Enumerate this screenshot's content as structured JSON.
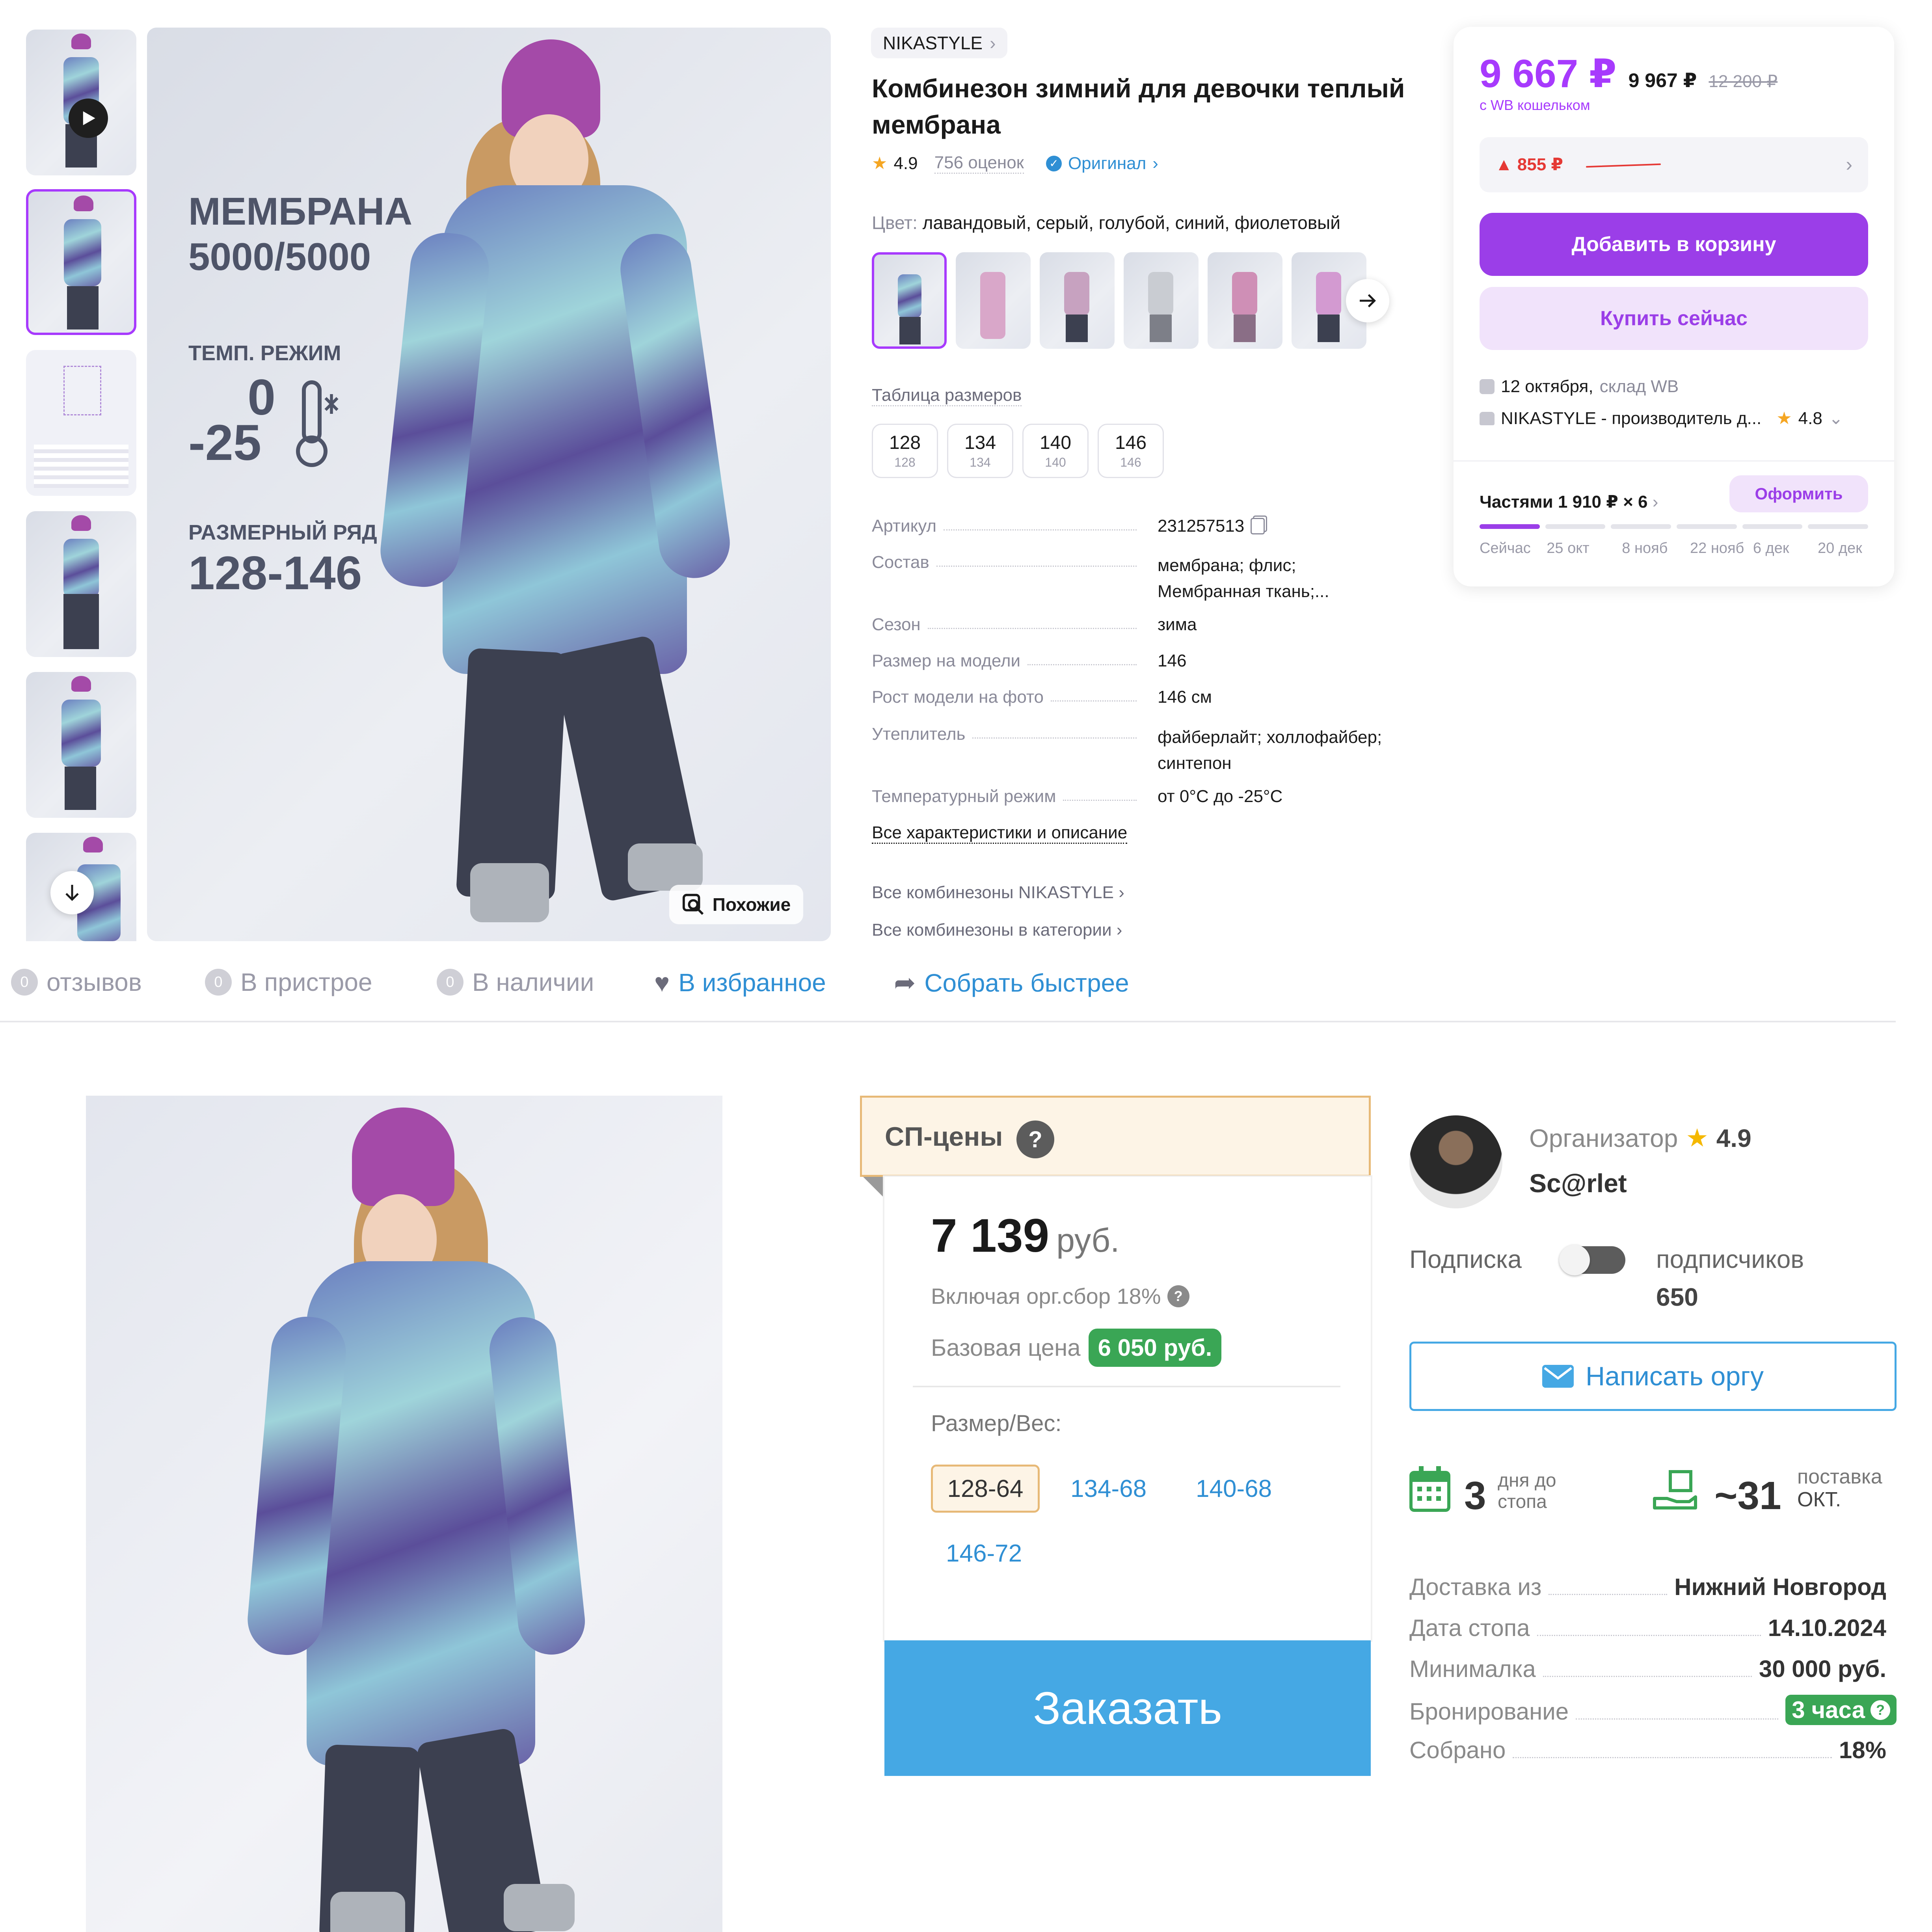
{
  "wb": {
    "brand": "NIKASTYLE",
    "title_line1": "Комбинезон зимний для девочки теплый",
    "title_line2": "мембрана",
    "rating": "4.9",
    "reviews": "756 оценок",
    "original": "Оригинал",
    "color_label": "Цвет:",
    "color_value": "лавандовый, серый, голубой, синий, фиолетовый",
    "size_table": "Таблица размеров",
    "sizes": [
      {
        "main": "128",
        "sub": "128"
      },
      {
        "main": "134",
        "sub": "134"
      },
      {
        "main": "140",
        "sub": "140"
      },
      {
        "main": "146",
        "sub": "146"
      }
    ],
    "specs": [
      {
        "k": "Артикул",
        "v1": "231257513",
        "v2": ""
      },
      {
        "k": "Состав",
        "v1": "мембрана; флис;",
        "v2": "Мембранная ткань;..."
      },
      {
        "k": "Сезон",
        "v1": "зима",
        "v2": ""
      },
      {
        "k": "Размер на модели",
        "v1": "146",
        "v2": ""
      },
      {
        "k": "Рост модели на фото",
        "v1": "146 см",
        "v2": ""
      },
      {
        "k": "Утеплитель",
        "v1": "файберлайт; холлофайбер;",
        "v2": "синтепон"
      },
      {
        "k": "Температурный режим",
        "v1": "от 0°C до -25°C",
        "v2": ""
      }
    ],
    "all_specs": "Все характеристики и описание",
    "link_brand": "Все комбинезоны NIKASTYLE",
    "link_category": "Все комбинезоны в категории",
    "similar": "Похожие",
    "promo": {
      "l1": "МЕМБРАНА",
      "l2": "5000/5000",
      "l3": "ТЕМП. РЕЖИМ",
      "l4": "0",
      "l5": "-25",
      "l6": "РАЗМЕРНЫЙ РЯД",
      "l7": "128-146"
    },
    "price_main": "9 667 ₽",
    "price_second": "9 967 ₽",
    "price_old": "12 200 ₽",
    "wallet": "с WB кошельком",
    "drop": "▲ 855 ₽",
    "add_cart": "Добавить в корзину",
    "buy_now": "Купить сейчас",
    "delivery_date": "12 октября,",
    "delivery_wh": "склад WB",
    "seller": "NIKASTYLE - производитель д...",
    "seller_rating": "4.8",
    "installment": "Частями 1 910 ₽ × 6",
    "checkout": "Оформить",
    "schedule": [
      "Сейчас",
      "25 окт",
      "8 нояб",
      "22 нояб",
      "6 дек",
      "20 дек"
    ],
    "schedule_filled": 0.17
  },
  "bar": {
    "reviews_count": "0",
    "reviews": "отзывов",
    "fitting_count": "0",
    "fitting": "В пристрое",
    "stock_count": "0",
    "stock": "В наличии",
    "fav": "В избранное",
    "fast": "Собрать быстрее"
  },
  "sp": {
    "header": "СП-цены",
    "help": "?",
    "price": "7 139",
    "price_unit": "руб.",
    "fee": "Включая орг.сбор 18%",
    "base_label": "Базовая цена",
    "base_value": "6 050 руб.",
    "size_label": "Размер/Вес:",
    "sizes": [
      "128-64",
      "134-68",
      "140-68",
      "146-72"
    ],
    "order": "Заказать",
    "org_label": "Организатор",
    "org_rating": "4.9",
    "org_name": "Sc@rlet",
    "sub_label": "Подписка",
    "subs_label": "подписчиков",
    "subs_count": "650",
    "write": "Написать оргу",
    "days": "3",
    "days_l1": "дня до",
    "days_l2": "стопа",
    "supply": "~31",
    "supply_l1": "поставка",
    "supply_l2": "ОКТ.",
    "info": [
      {
        "k": "Доставка из",
        "v": "Нижний Новгород"
      },
      {
        "k": "Дата стопа",
        "v": "14.10.2024"
      },
      {
        "k": "Минималка",
        "v": "30 000 руб."
      },
      {
        "k": "Бронирование",
        "v": "3 часа"
      },
      {
        "k": "Собрано",
        "v": "18%"
      }
    ]
  },
  "colors": {
    "purple": "#9b3ee8",
    "purple_light": "#f1e3fb",
    "price_purple": "#a73afd",
    "blue_link": "#2f8fd4",
    "green": "#3aa655",
    "sp_blue": "#45a8e4",
    "sp_header_bg": "#fdf4e6",
    "sp_header_border": "#e7b977",
    "red": "#e53935"
  }
}
